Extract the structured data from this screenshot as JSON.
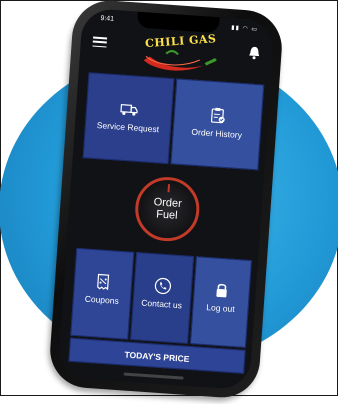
{
  "status_bar": {
    "time": "9:41",
    "icons": "▮▮ ◠ ▭"
  },
  "header": {
    "brand": "CHILI GAS"
  },
  "tiles": {
    "service_request": "Service Request",
    "order_history": "Order History",
    "order_fuel_line1": "Order",
    "order_fuel_line2": "Fuel",
    "coupons": "Coupons",
    "contact_us": "Contact us",
    "log_out": "Log out",
    "todays_price": "TODAY'S PRICE"
  },
  "colors": {
    "tile_blue": "#2e4496",
    "accent_red": "#c23a28",
    "backdrop_blue": "#2199d6",
    "brand_yellow": "#ffe24a"
  }
}
